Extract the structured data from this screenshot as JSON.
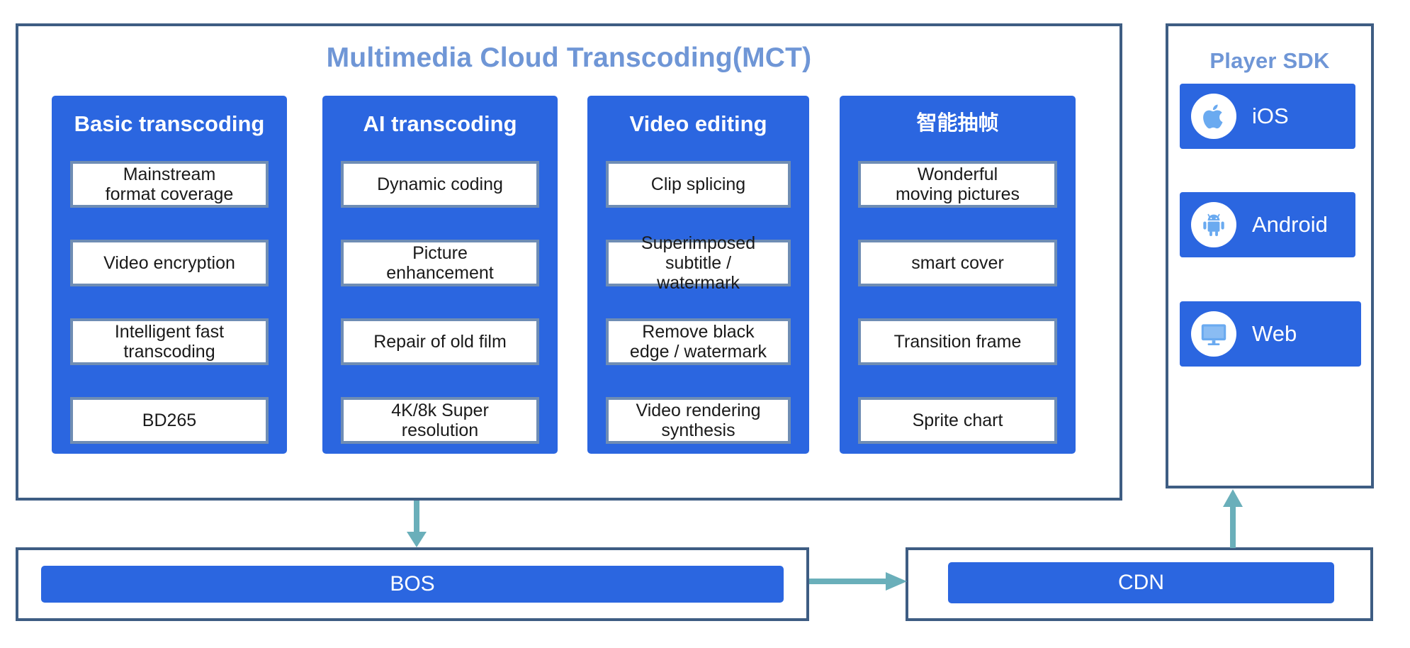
{
  "colors": {
    "frame_border": "#3e5d83",
    "panel_blue": "#2b66e0",
    "title_blue": "#6f96d6",
    "card_border": "#6f8db4",
    "arrow_teal": "#6aafba"
  },
  "mct": {
    "title": "Multimedia Cloud Transcoding(MCT)",
    "columns": [
      {
        "header": "Basic transcoding",
        "items": [
          "Mainstream\nformat coverage",
          "Video encryption",
          "Intelligent fast\ntranscoding",
          "BD265"
        ]
      },
      {
        "header": "AI transcoding",
        "items": [
          "Dynamic coding",
          "Picture\nenhancement",
          "Repair of old film",
          "4K/8k Super\nresolution"
        ]
      },
      {
        "header": "Video editing",
        "items": [
          "Clip splicing",
          "Superimposed\nsubtitle /\nwatermark",
          "Remove black\nedge / watermark",
          "Video rendering\nsynthesis"
        ]
      },
      {
        "header": "智能抽帧",
        "items": [
          "Wonderful\nmoving pictures",
          "smart cover",
          "Transition frame",
          "Sprite chart"
        ]
      }
    ]
  },
  "player_sdk": {
    "title": "Player SDK",
    "platforms": [
      {
        "label": "iOS",
        "icon": "apple-icon"
      },
      {
        "label": "Android",
        "icon": "android-icon"
      },
      {
        "label": "Web",
        "icon": "monitor-icon"
      }
    ]
  },
  "storage": {
    "bos_label": "BOS"
  },
  "delivery": {
    "cdn_label": "CDN"
  },
  "flow": {
    "mct_to_bos": "arrow-down",
    "bos_to_cdn": "arrow-right",
    "cdn_to_sdk": "arrow-up"
  }
}
